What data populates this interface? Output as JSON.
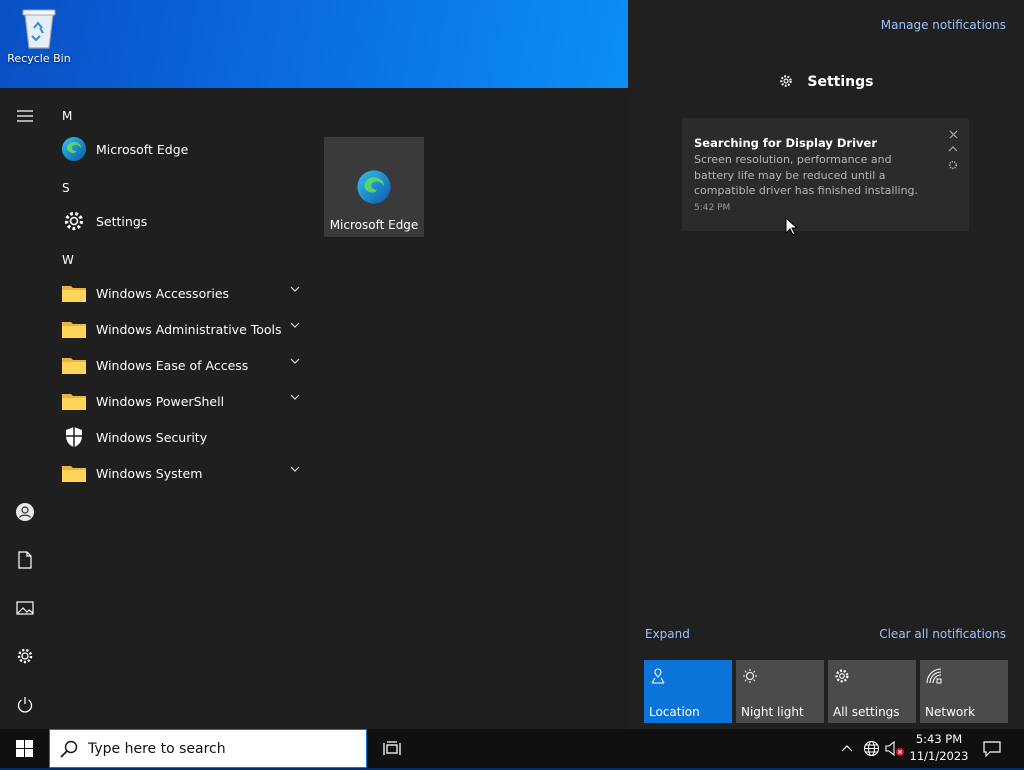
{
  "desktop": {
    "recycle_bin_label": "Recycle Bin"
  },
  "start_menu": {
    "sections": [
      {
        "letter": "M",
        "apps": [
          {
            "label": "Microsoft Edge",
            "icon": "edge-icon",
            "expandable": false
          }
        ]
      },
      {
        "letter": "S",
        "apps": [
          {
            "label": "Settings",
            "icon": "gear-icon",
            "expandable": false
          }
        ]
      },
      {
        "letter": "W",
        "apps": [
          {
            "label": "Windows Accessories",
            "icon": "folder-icon",
            "expandable": true
          },
          {
            "label": "Windows Administrative Tools",
            "icon": "folder-icon",
            "expandable": true
          },
          {
            "label": "Windows Ease of Access",
            "icon": "folder-icon",
            "expandable": true
          },
          {
            "label": "Windows PowerShell",
            "icon": "folder-icon",
            "expandable": true
          },
          {
            "label": "Windows Security",
            "icon": "shield-icon",
            "expandable": false
          },
          {
            "label": "Windows System",
            "icon": "folder-icon",
            "expandable": true
          }
        ]
      }
    ],
    "tile": {
      "label": "Microsoft Edge",
      "icon": "edge-icon"
    }
  },
  "action_center": {
    "manage_label": "Manage notifications",
    "group_title": "Settings",
    "notification": {
      "title": "Searching for Display Driver",
      "body": "Screen resolution, performance and battery life may be reduced until a compatible driver has finished installing.",
      "time": "5:42 PM"
    },
    "expand_label": "Expand",
    "clear_label": "Clear all notifications",
    "quick_actions": [
      {
        "label": "Location",
        "icon": "location-icon",
        "active": true
      },
      {
        "label": "Night light",
        "icon": "night-light-icon",
        "active": false
      },
      {
        "label": "All settings",
        "icon": "gear-icon",
        "active": false
      },
      {
        "label": "Network",
        "icon": "network-icon",
        "active": false
      }
    ]
  },
  "taskbar": {
    "search_placeholder": "Type here to search",
    "time": "5:43 PM",
    "date": "11/1/2023"
  },
  "colors": {
    "accent": "#0a74d8",
    "link": "#9bc3ff",
    "menu_bg": "#1f1f1f",
    "action_center_bg": "#202020"
  }
}
